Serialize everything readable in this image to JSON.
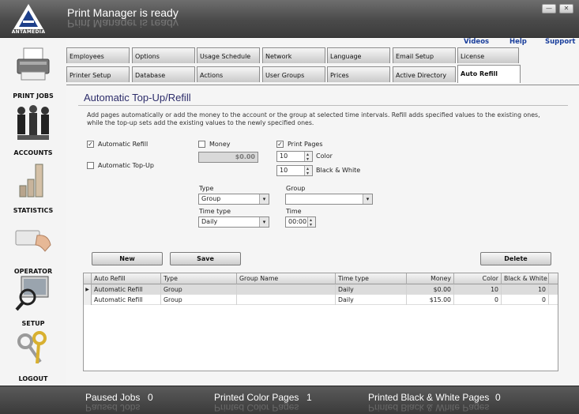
{
  "app": {
    "logo_text": "ANTAMEDIA",
    "status_title": "Print Manager is ready"
  },
  "window_controls": {
    "minimize": "—",
    "close": "✕"
  },
  "top_links": [
    "Videos",
    "Help",
    "Support"
  ],
  "sidebar": {
    "items": [
      {
        "label": "PRINT JOBS",
        "icon": "printer-icon"
      },
      {
        "label": "ACCOUNTS",
        "icon": "accounts-icon"
      },
      {
        "label": "STATISTICS",
        "icon": "statistics-icon"
      },
      {
        "label": "OPERATOR",
        "icon": "operator-icon"
      },
      {
        "label": "SETUP",
        "icon": "setup-icon"
      },
      {
        "label": "LOGOUT",
        "icon": "logout-icon"
      }
    ]
  },
  "tabs": {
    "row1": [
      "Employees",
      "Options",
      "Usage Schedule",
      "Network",
      "Language",
      "Email Setup",
      "License"
    ],
    "row2": [
      "Printer Setup",
      "Database",
      "Actions",
      "User Groups",
      "Prices",
      "Active Directory",
      "Auto Refill"
    ],
    "active": "Auto Refill"
  },
  "section": {
    "title": "Automatic Top-Up/Refill",
    "description": "Add pages automatically or add the money to the account or the group at selected time intervals. Refill adds specified values to the existing ones, while the top-up sets add the existing values to the newly specified ones."
  },
  "form": {
    "automatic_refill": {
      "label": "Automatic Refill",
      "checked": true
    },
    "automatic_topup": {
      "label": "Automatic Top-Up",
      "checked": false
    },
    "money": {
      "label": "Money",
      "checked": false,
      "value": "$0.00"
    },
    "print_pages": {
      "label": "Print Pages",
      "checked": true
    },
    "color": {
      "label": "Color",
      "value": "10"
    },
    "black_white": {
      "label": "Black & White",
      "value": "10"
    },
    "type": {
      "label": "Type",
      "value": "Group"
    },
    "group": {
      "label": "Group",
      "value": ""
    },
    "time_type": {
      "label": "Time type",
      "value": "Daily"
    },
    "time": {
      "label": "Time",
      "value": "00:00"
    }
  },
  "buttons": {
    "new": "New",
    "save": "Save",
    "delete": "Delete"
  },
  "grid": {
    "columns": [
      "Auto Refill",
      "Type",
      "Group Name",
      "Time type",
      "Money",
      "Color",
      "Black & White"
    ],
    "rows": [
      [
        "Automatic Refill",
        "Group",
        "",
        "Daily",
        "$0.00",
        "10",
        "10"
      ],
      [
        "Automatic Refill",
        "Group",
        "",
        "Daily",
        "$15.00",
        "0",
        "0"
      ]
    ]
  },
  "status": {
    "paused_jobs_label": "Paused Jobs",
    "paused_jobs_value": "0",
    "printed_color_label": "Printed Color Pages",
    "printed_color_value": "1",
    "printed_bw_label": "Printed Black & White Pages",
    "printed_bw_value": "0"
  }
}
